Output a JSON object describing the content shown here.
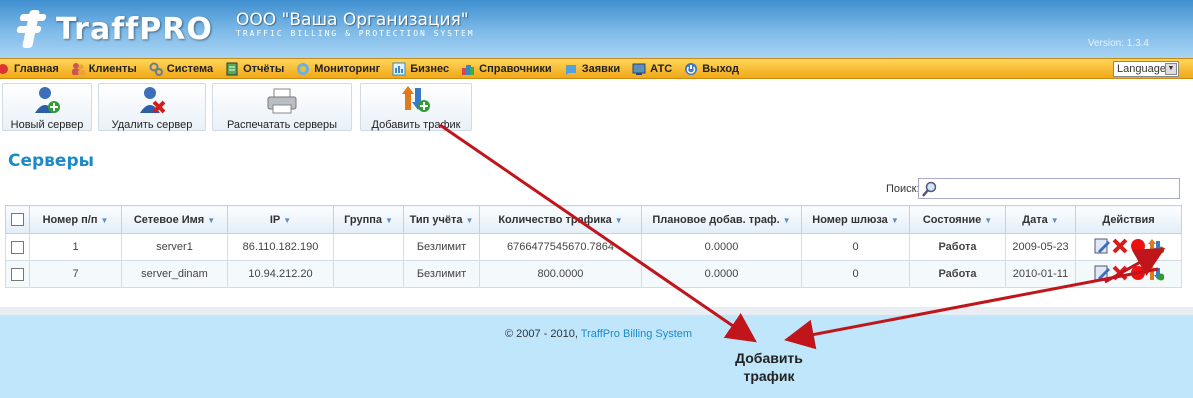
{
  "header": {
    "logo_text": "TraffPRO",
    "org_name": "ООО \"Ваша Организация\"",
    "tagline": "TRAFFIC BILLING & PROTECTION SYSTEM",
    "version": "Version: 1.3.4"
  },
  "nav": {
    "items": [
      {
        "label": "Главная",
        "icon": "home-icon"
      },
      {
        "label": "Клиенты",
        "icon": "users-icon"
      },
      {
        "label": "Система",
        "icon": "gears-icon"
      },
      {
        "label": "Отчёты",
        "icon": "reports-icon"
      },
      {
        "label": "Мониторинг",
        "icon": "monitoring-icon"
      },
      {
        "label": "Бизнес",
        "icon": "business-icon"
      },
      {
        "label": "Справочники",
        "icon": "reference-icon"
      },
      {
        "label": "Заявки",
        "icon": "requests-icon"
      },
      {
        "label": "АТС",
        "icon": "pbx-icon"
      },
      {
        "label": "Выход",
        "icon": "power-icon"
      }
    ],
    "language": "Language"
  },
  "toolbar": {
    "new_server": "Новый сервер",
    "delete_server": "Удалить сервер",
    "print_servers": "Распечатать серверы",
    "add_traffic": "Добавить трафик"
  },
  "page_title": "Серверы",
  "search": {
    "label": "Поиск:",
    "value": ""
  },
  "table": {
    "columns": [
      "Номер п/п",
      "Сетевое Имя",
      "IP",
      "Группа",
      "Тип учёта",
      "Количество трафика",
      "Плановое добав. траф.",
      "Номер шлюза",
      "Состояние",
      "Дата",
      "Действия"
    ],
    "rows": [
      {
        "num": "1",
        "name": "server1",
        "ip": "86.110.182.190",
        "group": "",
        "type": "Безлимит",
        "traffic": "6766477545670.7864",
        "planned": "0.0000",
        "gateway": "0",
        "state": "Работа",
        "date": "2009-05-23"
      },
      {
        "num": "7",
        "name": "server_dinam",
        "ip": "10.94.212.20",
        "group": "",
        "type": "Безлимит",
        "traffic": "800.0000",
        "planned": "0.0000",
        "gateway": "0",
        "state": "Работа",
        "date": "2010-01-11"
      }
    ]
  },
  "footer": {
    "copyright_prefix": "© 2007 - 2010, ",
    "copyright_brand": "TraffPro Billing System"
  },
  "annotation": {
    "line1": "Добавить",
    "line2": "трафик",
    "arrow_color": "#c0151b"
  }
}
